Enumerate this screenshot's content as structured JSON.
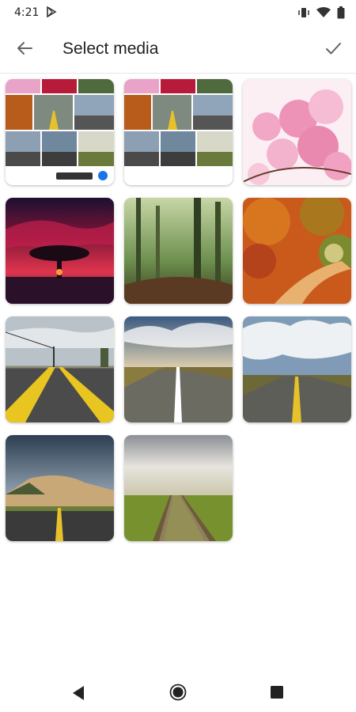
{
  "status_bar": {
    "time": "4:21",
    "icons": [
      "play-store-icon",
      "vibrate-icon",
      "wifi-icon",
      "battery-icon"
    ]
  },
  "app_bar": {
    "title": "Select media",
    "back_icon": "arrow-back-icon",
    "confirm_icon": "checkmark-icon"
  },
  "media": {
    "items": [
      {
        "name": "media-screenshot-1",
        "kind": "screenshot collage"
      },
      {
        "name": "media-screenshot-2",
        "kind": "screenshot collage"
      },
      {
        "name": "media-cherry-blossom",
        "kind": "photo"
      },
      {
        "name": "media-tree-sunset",
        "kind": "photo"
      },
      {
        "name": "media-misty-forest",
        "kind": "photo"
      },
      {
        "name": "media-autumn-path",
        "kind": "photo"
      },
      {
        "name": "media-road-yellow-lines",
        "kind": "photo"
      },
      {
        "name": "media-road-white-line",
        "kind": "photo"
      },
      {
        "name": "media-road-prairie",
        "kind": "photo"
      },
      {
        "name": "media-road-mountain",
        "kind": "photo"
      },
      {
        "name": "media-railway-tracks",
        "kind": "photo"
      }
    ]
  },
  "nav_bar": {
    "icons": [
      "nav-back-icon",
      "nav-home-icon",
      "nav-recents-icon"
    ]
  },
  "colors": {
    "accent": "#1a73e8",
    "text": "#202124",
    "icon": "#5f6368"
  }
}
